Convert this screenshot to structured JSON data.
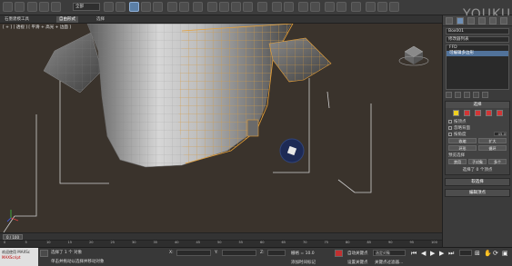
{
  "toolbar": {
    "selection_filter": "全部",
    "title_hint": "Autodesk 3ds Max"
  },
  "ribbon": {
    "tabs": [
      "石墨建模工具",
      "自由形式",
      "选择"
    ],
    "active_tab": 1
  },
  "viewport": {
    "label": "[ + ] [ 透视 ] [ 平滑 + 高光 + 边面 ]",
    "colors": {
      "background": "#3a332c",
      "mesh_wire": "#e6a13a",
      "grid": "#c9c9c9"
    }
  },
  "command_panel": {
    "object_name": "Box001",
    "modifier_list": "修改器列表",
    "stack": [
      "FFD",
      "可编辑多边形"
    ],
    "stack_selected": 1,
    "selection_rollout": {
      "title": "选择",
      "checkboxes": [
        {
          "label": "按顶点",
          "value": ""
        },
        {
          "label": "忽略背面",
          "value": ""
        },
        {
          "label": "按角度",
          "value": "45.0"
        }
      ],
      "buttons_row1": [
        "收缩",
        "扩大"
      ],
      "buttons_row2": [
        "环形",
        "循环"
      ],
      "preview_title": "预览选择",
      "preview_options": [
        "禁用",
        "子对象",
        "多个"
      ],
      "status": "选择了 0 个顶点"
    },
    "soft_selection_title": "软选择",
    "edit_vertices_title": "编辑顶点"
  },
  "timeline": {
    "frame_indicator": "0 / 100",
    "ticks": [
      "0",
      "5",
      "10",
      "15",
      "20",
      "25",
      "30",
      "35",
      "40",
      "45",
      "50",
      "55",
      "60",
      "65",
      "70",
      "75",
      "80",
      "85",
      "90",
      "95",
      "100"
    ]
  },
  "statusbar": {
    "welcome_title": "欢迎使用 MAXSc",
    "welcome_sub": "MAXScript",
    "selected": "选择了 1 个 对象",
    "hint": "单击并拖动以选择并移动对象",
    "coord_x": "X:",
    "coord_y": "Y:",
    "coord_z": "Z:",
    "grid": "栅格 = 10.0",
    "auto_key": "自动关键点",
    "set_key": "设置关键点",
    "selected_obj": "选定对象",
    "key_filter": "关键点过滤器...",
    "add_time_tag": "添加时间标记"
  },
  "watermark": {
    "brand": "YOUKU",
    "sub": "优酷"
  }
}
